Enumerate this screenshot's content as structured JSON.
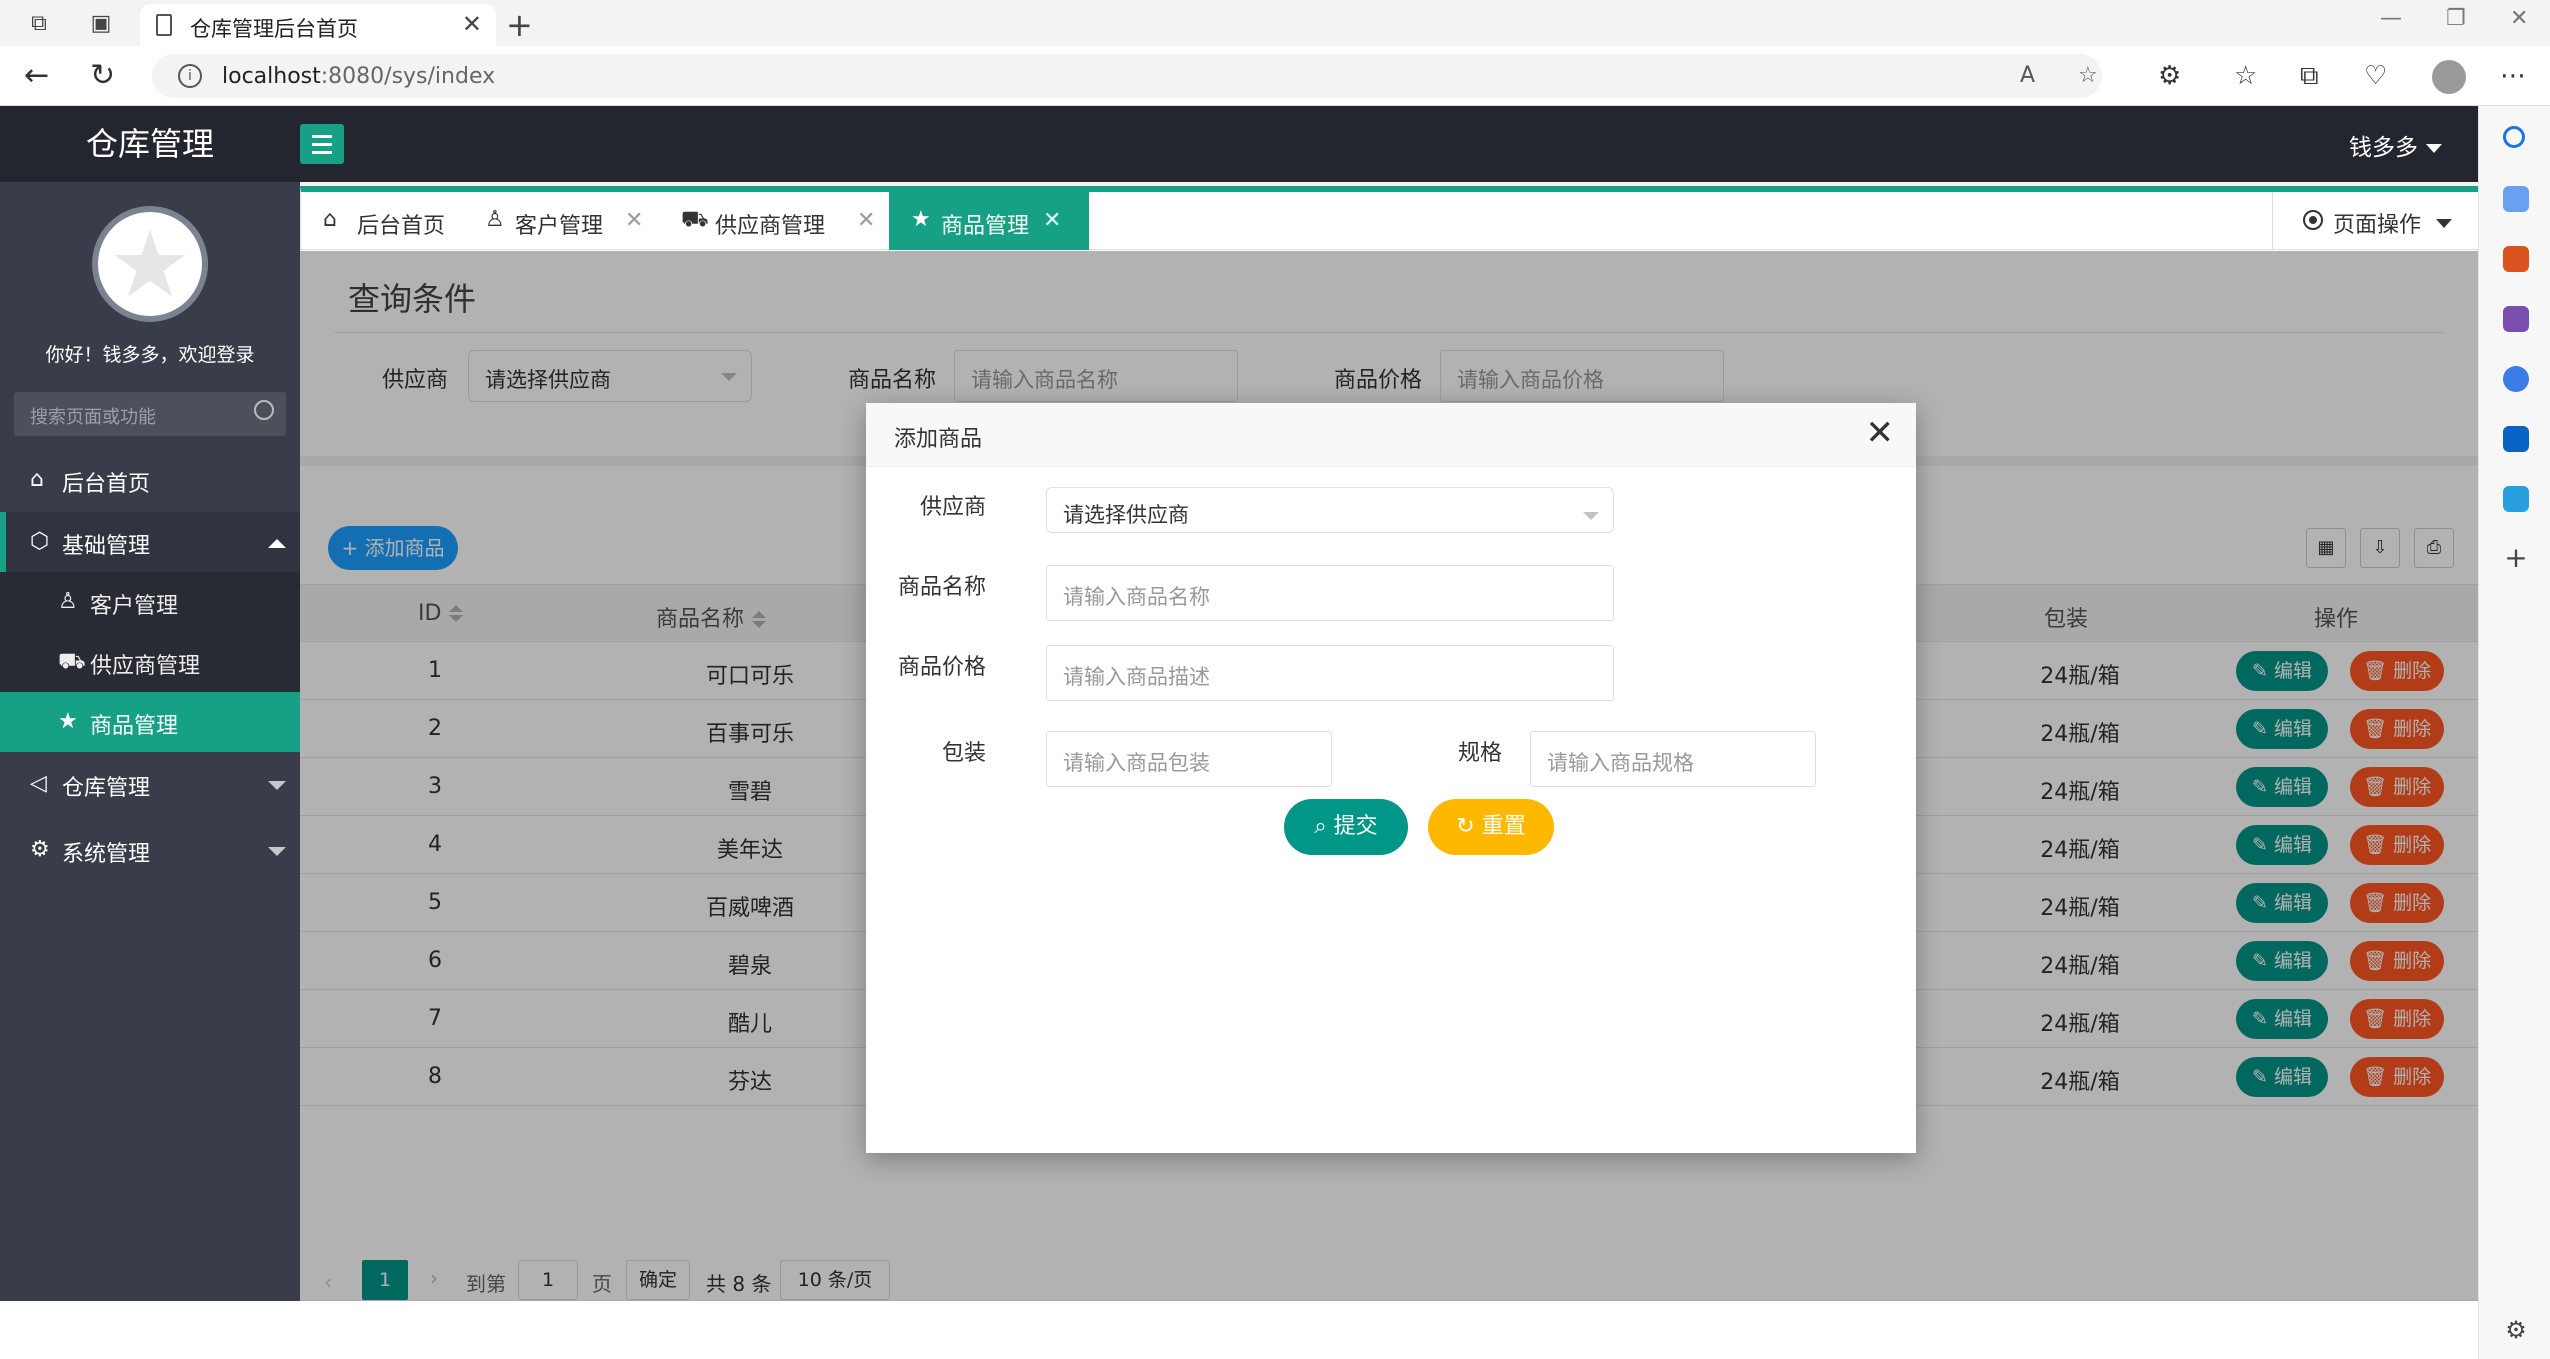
{
  "browser": {
    "tab_title": "仓库管理后台首页",
    "url_host": "localhost",
    "url_rest": ":8080/sys/index"
  },
  "app": {
    "logo": "仓库管理",
    "user": "钱多多",
    "greeting": "你好！钱多多，欢迎登录",
    "search_placeholder": "搜索页面或功能"
  },
  "sidebar": {
    "home": "后台首页",
    "basic": "基础管理",
    "customer": "客户管理",
    "supplier": "供应商管理",
    "goods": "商品管理",
    "warehouse": "仓库管理",
    "system": "系统管理"
  },
  "tabs": {
    "home": "后台首页",
    "customer": "客户管理",
    "supplier": "供应商管理",
    "goods": "商品管理",
    "page_ops": "页面操作"
  },
  "query": {
    "title": "查询条件",
    "supplier_label": "供应商",
    "supplier_value": "请选择供应商",
    "name_label": "商品名称",
    "name_placeholder": "请输入商品名称",
    "price_label": "商品价格",
    "price_placeholder": "请输入商品价格"
  },
  "toolbar": {
    "add": "添加商品"
  },
  "table": {
    "col_id": "ID",
    "col_name": "商品名称",
    "col_pack": "包装",
    "col_ops": "操作",
    "edit": "编辑",
    "delete": "删除",
    "rows": [
      {
        "id": "1",
        "name": "可口可乐",
        "pack": "24瓶/箱"
      },
      {
        "id": "2",
        "name": "百事可乐",
        "pack": "24瓶/箱"
      },
      {
        "id": "3",
        "name": "雪碧",
        "pack": "24瓶/箱"
      },
      {
        "id": "4",
        "name": "美年达",
        "pack": "24瓶/箱"
      },
      {
        "id": "5",
        "name": "百威啤酒",
        "pack": "24瓶/箱"
      },
      {
        "id": "6",
        "name": "碧泉",
        "pack": "24瓶/箱"
      },
      {
        "id": "7",
        "name": "酷儿",
        "pack": "24瓶/箱"
      },
      {
        "id": "8",
        "name": "芬达",
        "pack": "24瓶/箱"
      }
    ]
  },
  "pager": {
    "current": "1",
    "goto_label": "到第",
    "goto_value": "1",
    "page_label": "页",
    "confirm": "确定",
    "total": "共 8 条",
    "per_page": "10 条/页"
  },
  "modal": {
    "title": "添加商品",
    "supplier_label": "供应商",
    "supplier_value": "请选择供应商",
    "name_label": "商品名称",
    "name_placeholder": "请输入商品名称",
    "price_label": "商品价格",
    "price_placeholder": "请输入商品描述",
    "pack_label": "包装",
    "pack_placeholder": "请输入商品包装",
    "spec_label": "规格",
    "spec_placeholder": "请输入商品规格",
    "submit": "提交",
    "reset": "重置"
  }
}
